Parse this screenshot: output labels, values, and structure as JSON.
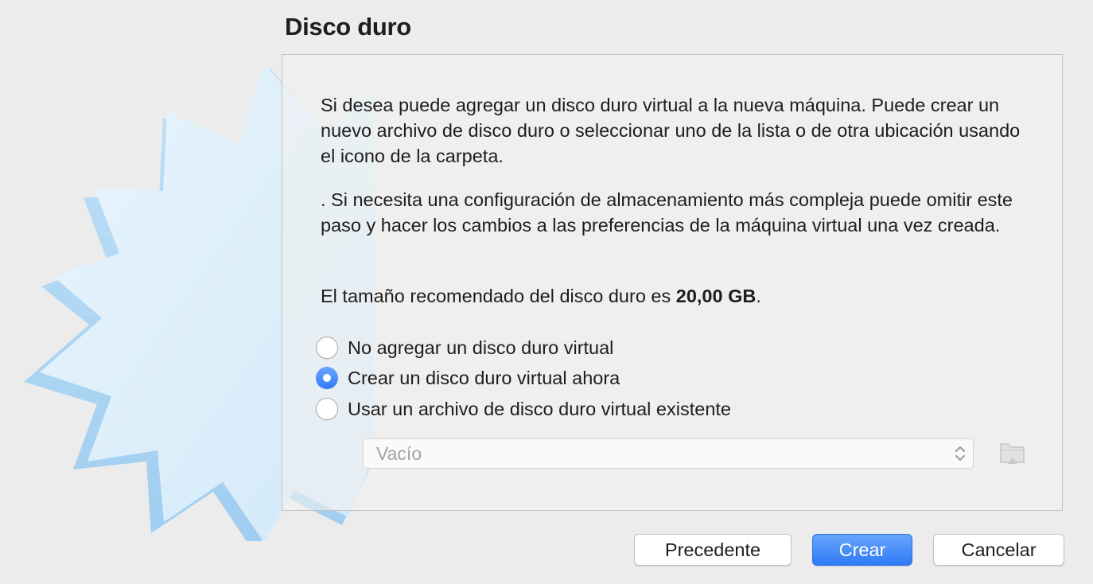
{
  "dialog": {
    "title": "Disco duro"
  },
  "content": {
    "paragraph_1": "Si desea puede agregar un disco duro virtual a la nueva máquina. Puede crear un nuevo archivo de disco duro o seleccionar uno de la lista o de otra ubicación usando el icono de la carpeta.",
    "paragraph_2": ". Si necesita una configuración de almacenamiento más compleja puede omitir este paso y hacer los cambios a las preferencias de la máquina virtual una vez creada.",
    "recommended_prefix": "El tamaño recomendado del disco duro es ",
    "recommended_size": "20,00 GB",
    "recommended_suffix": "."
  },
  "options": [
    {
      "label": "No agregar un disco duro virtual",
      "selected": false
    },
    {
      "label": "Crear un disco duro virtual ahora",
      "selected": true
    },
    {
      "label": "Usar un archivo de disco duro virtual existente",
      "selected": false
    }
  ],
  "disk_select": {
    "value": "Vacío",
    "enabled": false
  },
  "icons": {
    "watermark": "hard-disk-starburst-watermark",
    "folder": "folder-icon",
    "select_arrows": "up-down-chevron-icon"
  },
  "buttons": {
    "back": "Precedente",
    "create": "Crear",
    "cancel": "Cancelar"
  },
  "colors": {
    "accent": "#2f7cf6",
    "watermark": "#bfe0f7"
  }
}
